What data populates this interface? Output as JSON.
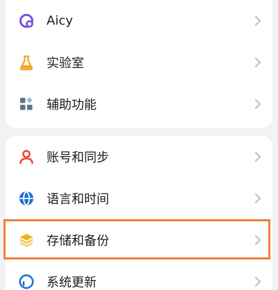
{
  "settings": {
    "items": [
      {
        "label": "Aicy",
        "icon": "aicy-icon",
        "icon_color": "#7a4de0"
      },
      {
        "label": "实验室",
        "icon": "flask-icon",
        "icon_color": "#f1a82a"
      },
      {
        "label": "辅助功能",
        "icon": "accessibility-grid-icon",
        "icon_color": "#5f7388"
      },
      {
        "label": "账号和同步",
        "icon": "user-icon",
        "icon_color": "#e9473d"
      },
      {
        "label": "语言和时间",
        "icon": "globe-icon",
        "icon_color": "#1d6fd6"
      },
      {
        "label": "存储和备份",
        "icon": "layers-icon",
        "icon_color": "#f1b222"
      },
      {
        "label": "系统更新",
        "icon": "update-icon",
        "icon_color": "#1d6fd6"
      }
    ]
  },
  "highlight": {
    "target": "存储和备份",
    "color": "#f07c3a"
  }
}
